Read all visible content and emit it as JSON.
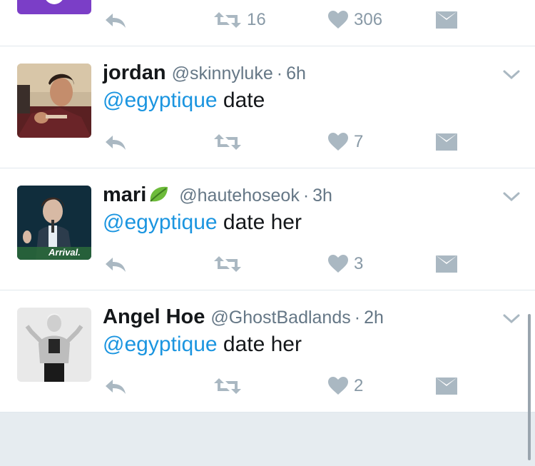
{
  "tweets": [
    {
      "name": "",
      "handle": "",
      "time": "",
      "text": "",
      "retweets": "16",
      "likes": "306"
    },
    {
      "name": "jordan",
      "handle": "@skinnyluke",
      "time": "6h",
      "mention": "@egyptique",
      "text": " date",
      "retweets": "",
      "likes": "7"
    },
    {
      "name": "mari",
      "handle": "@hautehoseok",
      "time": "3h",
      "mention": "@egyptique",
      "text": " date her",
      "retweets": "",
      "likes": "3",
      "avatar_caption": "Arrival."
    },
    {
      "name": "Angel Hoe",
      "handle": "@GhostBadlands",
      "time": "2h",
      "mention": "@egyptique",
      "text": " date her",
      "retweets": "",
      "likes": "2"
    }
  ],
  "separator": "·",
  "colors": {
    "mention": "#1b95e0",
    "meta": "#657786",
    "icon": "#aab8c2",
    "background_footer": "#e6ecf0"
  }
}
